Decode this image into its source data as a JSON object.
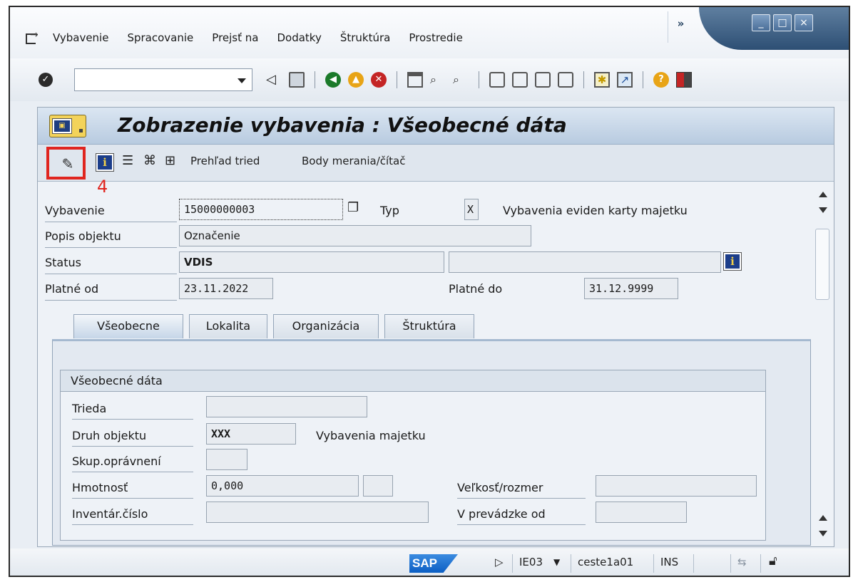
{
  "menu": {
    "items": [
      {
        "label": "Vybavenie"
      },
      {
        "label": "Spracovanie"
      },
      {
        "label": "Prejsť na"
      },
      {
        "label": "Dodatky"
      },
      {
        "label": "Štruktúra"
      },
      {
        "label": "Prostredie"
      }
    ],
    "overflow": "»"
  },
  "window_controls": {
    "minimize": "_",
    "maximize": "□",
    "close": "×"
  },
  "toolbar": {
    "command_value": ""
  },
  "screen": {
    "title": "Zobrazenie vybavenia : Všeobecné dáta",
    "app_toolbar": {
      "class_overview": "Prehľad tried",
      "measuring_points": "Body merania/čítač"
    },
    "annotation": {
      "step": "4",
      "color": "#e0251f"
    }
  },
  "header": {
    "equipment_label": "Vybavenie",
    "equipment_value": "15000000003",
    "type_label": "Typ",
    "type_value": "X",
    "type_text": "Vybavenia eviden karty majetku",
    "description_label": "Popis objektu",
    "description_value": "Označenie",
    "status_label": "Status",
    "status_value": "VDIS",
    "status_extra": "",
    "valid_from_label": "Platné od",
    "valid_from_value": "23.11.2022",
    "valid_to_label": "Platné do",
    "valid_to_value": "31.12.9999"
  },
  "tabs": [
    {
      "label": "Všeobecne",
      "active": true
    },
    {
      "label": "Lokalita",
      "active": false
    },
    {
      "label": "Organizácia",
      "active": false
    },
    {
      "label": "Štruktúra",
      "active": false
    }
  ],
  "general_data": {
    "group_title": "Všeobecné dáta",
    "class_label": "Trieda",
    "class_value": "",
    "object_type_label": "Druh objektu",
    "object_type_value": "XXX",
    "object_type_text": "Vybavenia majetku",
    "auth_group_label": "Skup.oprávnení",
    "auth_group_value": "",
    "weight_label": "Hmotnosť",
    "weight_value": "0,000",
    "weight_unit": "",
    "size_label": "Veľkosť/rozmer",
    "size_value": "",
    "inventory_label": "Inventár.číslo",
    "inventory_value": "",
    "startup_label": "V prevádzke od",
    "startup_value": ""
  },
  "status_bar": {
    "logo": "SAP",
    "transaction": "IE03",
    "server": "ceste1a01",
    "mode": "INS"
  }
}
